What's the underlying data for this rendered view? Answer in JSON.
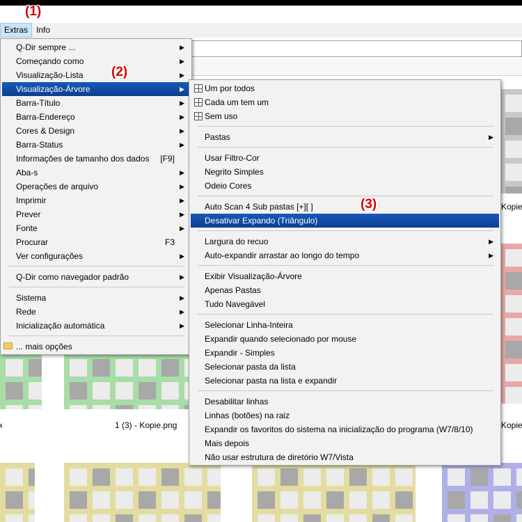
{
  "menubar": {
    "items": [
      {
        "label": "Extras"
      },
      {
        "label": "Info"
      }
    ]
  },
  "callouts": [
    "(1)",
    "(2)",
    "(3)"
  ],
  "extras_menu": {
    "items": [
      {
        "label": "Q-Dir sempre ..."
      },
      {
        "label": "Começando como"
      },
      {
        "label": "Visualização-Lista"
      },
      {
        "label": "Visualização-Árvore"
      },
      {
        "label": "Barra-Título"
      },
      {
        "label": "Barra-Endereço"
      },
      {
        "label": "Cores & Design"
      },
      {
        "label": "Barra-Status"
      },
      {
        "label": "Informações de tamanho dos dados",
        "shortcut": "[F9]"
      },
      {
        "label": "Aba-s"
      },
      {
        "label": "Operações de arquivo"
      },
      {
        "label": "Imprimir"
      },
      {
        "label": "Prever"
      },
      {
        "label": "Fonte"
      },
      {
        "label": "Procurar",
        "shortcut": "F3"
      },
      {
        "label": "Ver configurações"
      },
      {
        "label": "Q-Dir como navegador padrão"
      },
      {
        "label": "Sistema"
      },
      {
        "label": "Rede"
      },
      {
        "label": "Inicialização automática"
      },
      {
        "label": "... mais opções"
      }
    ]
  },
  "tree_submenu": {
    "items": [
      {
        "label": "Um por todos"
      },
      {
        "label": "Cada um tem um"
      },
      {
        "label": "Sem uso"
      },
      {
        "label": "Pastas"
      },
      {
        "label": "Usar Filtro-Cor"
      },
      {
        "label": "Negrito Simples"
      },
      {
        "label": "Odeio Cores"
      },
      {
        "label": "Auto Scan 4 Sub pastas [+][ ]"
      },
      {
        "label": "Desativar Expando (Triângulo)"
      },
      {
        "label": "Largura do recuo"
      },
      {
        "label": "Auto-expandir arrastar ao longo do tempo"
      },
      {
        "label": "Exibir Visualização-Árvore"
      },
      {
        "label": "Apenas Pastas"
      },
      {
        "label": "Tudo Navegável"
      },
      {
        "label": "Selecionar Linha-Inteira"
      },
      {
        "label": "Expandir quando selecionado por mouse"
      },
      {
        "label": "Expandir - Simples"
      },
      {
        "label": "Selecionar pasta da lista"
      },
      {
        "label": "Selecionar pasta na lista e expandir"
      },
      {
        "label": "Desabilitar linhas"
      },
      {
        "label": "Linhas (botões) na raiz"
      },
      {
        "label": "Expandir os favoritos do sistema na inicialização do programa (W7/8/10)"
      },
      {
        "label": "Mais depois"
      },
      {
        "label": "Não usar estrutura de diretório W7/Vista"
      }
    ]
  },
  "file_captions": [
    "Kopie",
    "1 (3) - Kopie.png",
    "Kopie"
  ],
  "colors": {
    "highlight": "#0d3f8f",
    "callout": "#d40000",
    "thumb_gray": "#c8c8c8",
    "thumb_red": "#e8a8a8",
    "thumb_green": "#a8dca8",
    "thumb_yellow": "#e2dca0",
    "thumb_blue": "#b0b0e8"
  }
}
